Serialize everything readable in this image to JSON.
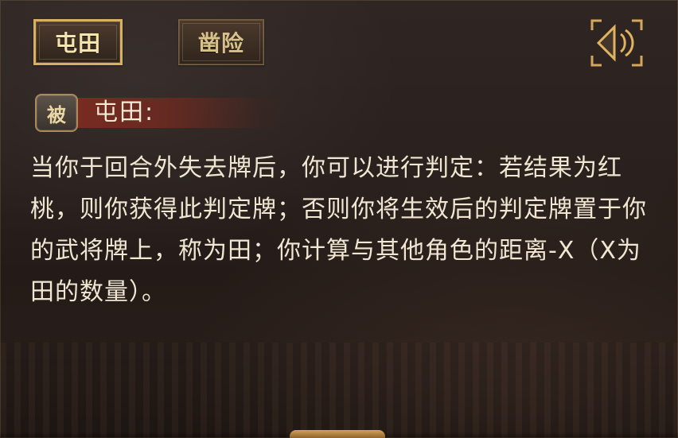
{
  "tabs": [
    {
      "label": "屯田",
      "active": true
    },
    {
      "label": "凿险",
      "active": false
    }
  ],
  "controls": {
    "sound_icon": "sound-icon"
  },
  "skill": {
    "badge": "被",
    "title": "屯田:",
    "description": "当你于回合外失去牌后，你可以进行判定：若结果为红桃，则你获得此判定牌；否则你将生效后的判定牌置于你的武将牌上，称为田；你计算与其他角色的距离-X（X为田的数量）。"
  },
  "colors": {
    "accent_gold": "#d7b064",
    "text_light": "#f0e6d2",
    "header_red": "#7e2b1f"
  }
}
